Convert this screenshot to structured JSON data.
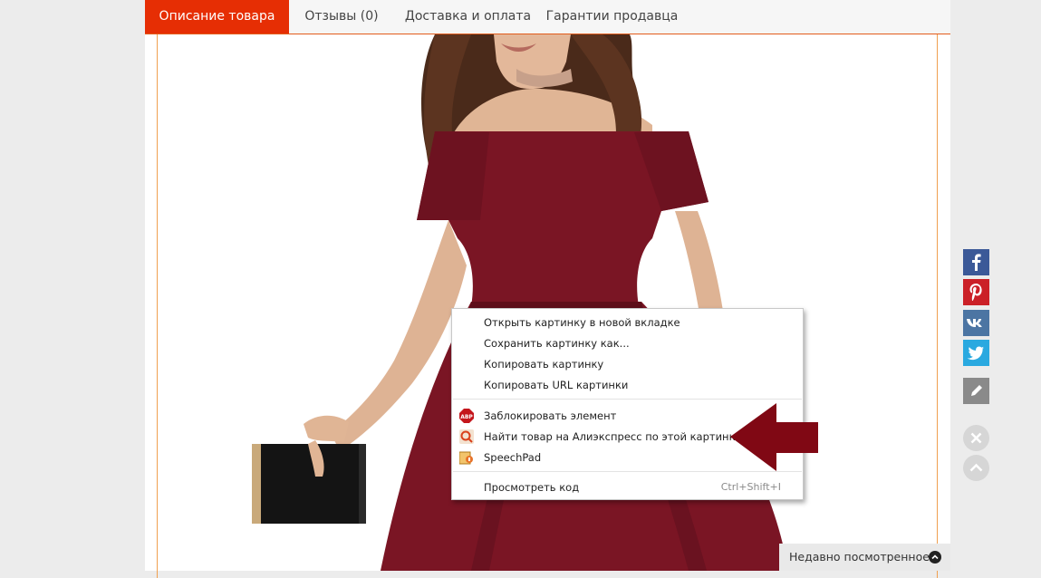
{
  "tabs": [
    {
      "label": "Описание товара"
    },
    {
      "label": "Отзывы (0)"
    },
    {
      "label": "Доставка и оплата"
    },
    {
      "label": "Гарантии продавца"
    }
  ],
  "context_menu": {
    "items": [
      {
        "label": "Открыть картинку в новой вкладке"
      },
      {
        "label": "Сохранить картинку как..."
      },
      {
        "label": "Копировать картинку"
      },
      {
        "label": "Копировать URL картинки"
      },
      {
        "label": "Заблокировать элемент",
        "icon": "adblock-icon"
      },
      {
        "label": "Найти товар на Алиэкспресс по этой картинке",
        "icon": "aliexpress-search-icon"
      },
      {
        "label": "SpeechPad",
        "icon": "speechpad-icon"
      },
      {
        "label": "Просмотреть код",
        "shortcut": "Ctrl+Shift+I"
      }
    ]
  },
  "social": [
    "facebook-icon",
    "pinterest-icon",
    "vk-icon",
    "twitter-icon",
    "edit-icon"
  ],
  "recently_viewed": {
    "label": "Недавно посмотренное"
  },
  "colors": {
    "accent": "#e62e04",
    "dress": "#7a1524",
    "arrow": "#800814"
  }
}
